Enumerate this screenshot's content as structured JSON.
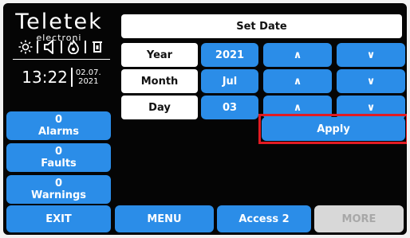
{
  "brand": {
    "name": "Teletek",
    "sub": "electroni"
  },
  "status_icons": [
    "sun-icon",
    "speaker-icon",
    "fire-icon",
    "bell-icon"
  ],
  "clock": {
    "time": "13:22",
    "date_line1": "02.07.",
    "date_line2": "2021"
  },
  "counters": [
    {
      "count": "0",
      "label": "Alarms"
    },
    {
      "count": "0",
      "label": "Faults"
    },
    {
      "count": "0",
      "label": "Warnings"
    }
  ],
  "panel": {
    "title": "Set Date",
    "rows": [
      {
        "label": "Year",
        "value": "2021"
      },
      {
        "label": "Month",
        "value": "Jul"
      },
      {
        "label": "Day",
        "value": "03"
      }
    ],
    "up_glyph": "∧",
    "down_glyph": "∨",
    "apply_label": "Apply"
  },
  "bottom_bar": {
    "exit": "EXIT",
    "menu": "MENU",
    "access": "Access 2",
    "more": "MORE"
  },
  "colors": {
    "accent": "#2b8de8",
    "background": "#050505",
    "highlight": "#e21b23",
    "disabled": "#d8d8d8"
  }
}
